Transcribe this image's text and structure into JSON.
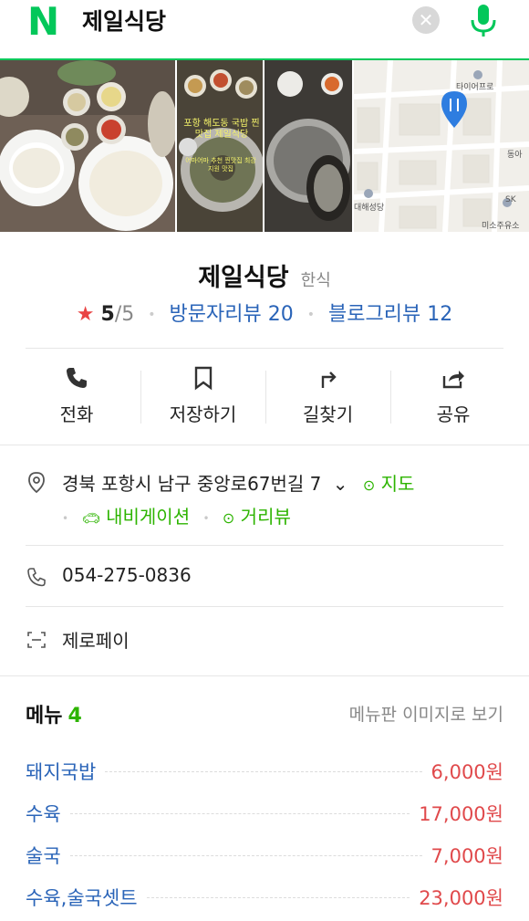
{
  "search": {
    "logo": "N",
    "query": "제일식당"
  },
  "place": {
    "name": "제일식당",
    "category": "한식",
    "rating": "5",
    "rating_max": "/5",
    "visitor_reviews": "방문자리뷰 20",
    "blog_reviews": "블로그리뷰 12"
  },
  "photos": {
    "overlay_caption": "포항 해도동 국밥 찐맛집 제일식당",
    "overlay_sub": "어마어마 추천 찐맛집 최강 지원 맛집"
  },
  "map": {
    "labels": [
      "타이어프로",
      "동아",
      "대해성당",
      "SK",
      "미소주유소"
    ]
  },
  "actions": [
    {
      "label": "전화",
      "icon": "phone-icon"
    },
    {
      "label": "저장하기",
      "icon": "bookmark-icon"
    },
    {
      "label": "길찾기",
      "icon": "directions-icon"
    },
    {
      "label": "공유",
      "icon": "share-icon"
    }
  ],
  "info": {
    "address": "경북 포항시 남구 중앙로67번길 7",
    "map_link": "지도",
    "navigation_link": "내비게이션",
    "streetview_link": "거리뷰",
    "phone": "054-275-0836",
    "zeropay": "제로페이"
  },
  "menu": {
    "title": "메뉴",
    "count": "4",
    "board_link": "메뉴판 이미지로 보기",
    "items": [
      {
        "name": "돼지국밥",
        "price": "6,000원"
      },
      {
        "name": "수육",
        "price": "17,000원"
      },
      {
        "name": "술국",
        "price": "7,000원"
      },
      {
        "name": "수육,술국셋트",
        "price": "23,000원"
      }
    ]
  },
  "colors": {
    "brand_green": "#03c75a",
    "link_blue": "#2a64b8",
    "price_red": "#e0494b",
    "star_red": "#e94444"
  }
}
